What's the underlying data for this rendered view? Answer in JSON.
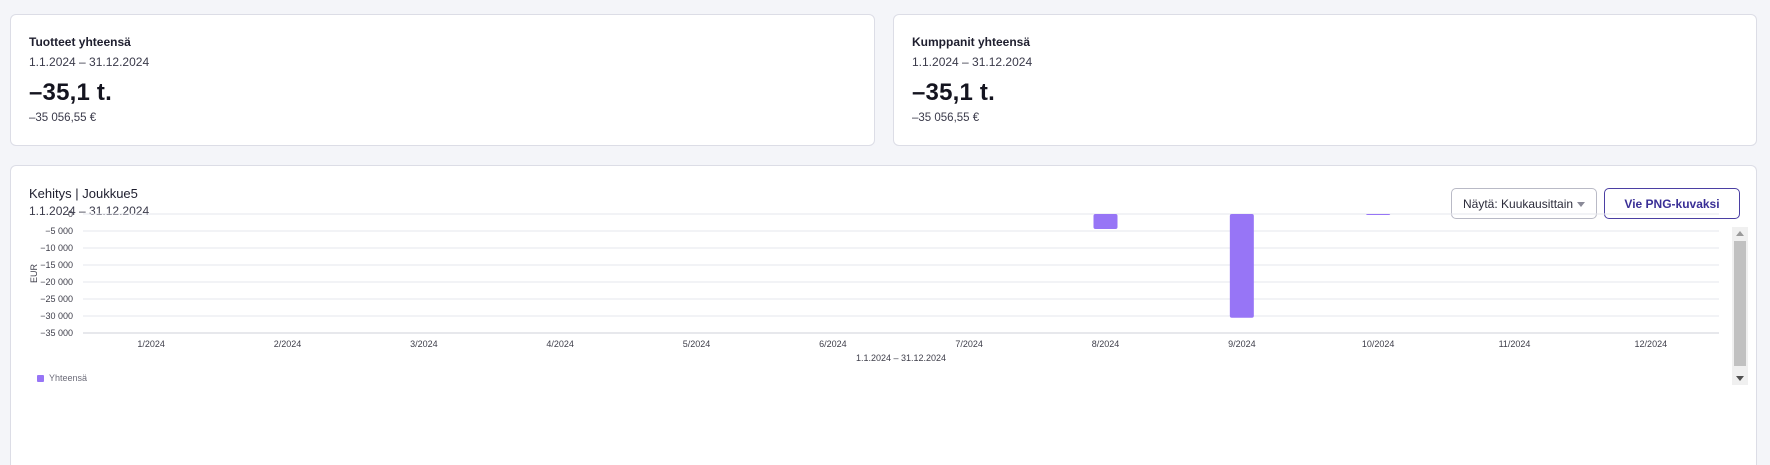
{
  "kpi_cards": [
    {
      "title": "Tuotteet yhteensä",
      "range": "1.1.2024 – 31.12.2024",
      "big_value": "–35,1 t.",
      "small_value": "–35 056,55 €"
    },
    {
      "title": "Kumppanit yhteensä",
      "range": "1.1.2024 – 31.12.2024",
      "big_value": "–35,1 t.",
      "small_value": "–35 056,55 €"
    }
  ],
  "chart_card": {
    "title": "Kehitys | Joukkue5",
    "range": "1.1.2024 – 31.12.2024",
    "view_select": {
      "label": "Näytä: Kuukausittain",
      "icon": "chevron-down-icon"
    },
    "export_label": "Vie PNG-kuvaksi"
  },
  "chart_data": {
    "type": "bar",
    "title": "",
    "categories": [
      "1/2024",
      "2/2024",
      "3/2024",
      "4/2024",
      "5/2024",
      "6/2024",
      "7/2024",
      "8/2024",
      "9/2024",
      "10/2024",
      "11/2024",
      "12/2024"
    ],
    "series": [
      {
        "name": "Yhteensä",
        "color": "#9775f6",
        "values": [
          0,
          0,
          0,
          0,
          0,
          0,
          0,
          -4400,
          -30500,
          -150,
          0,
          0
        ]
      }
    ],
    "xlabel": "1.1.2024 – 31.12.2024",
    "ylabel": "EUR",
    "ylim": [
      -35000,
      0
    ],
    "yticks": [
      0,
      -5000,
      -10000,
      -15000,
      -20000,
      -25000,
      -30000,
      -35000
    ],
    "ytick_labels": [
      "0",
      "−5 000",
      "−10 000",
      "−15 000",
      "−20 000",
      "−25 000",
      "−30 000",
      "−35 000"
    ],
    "grid": true,
    "legend_position": "bottom-left"
  }
}
